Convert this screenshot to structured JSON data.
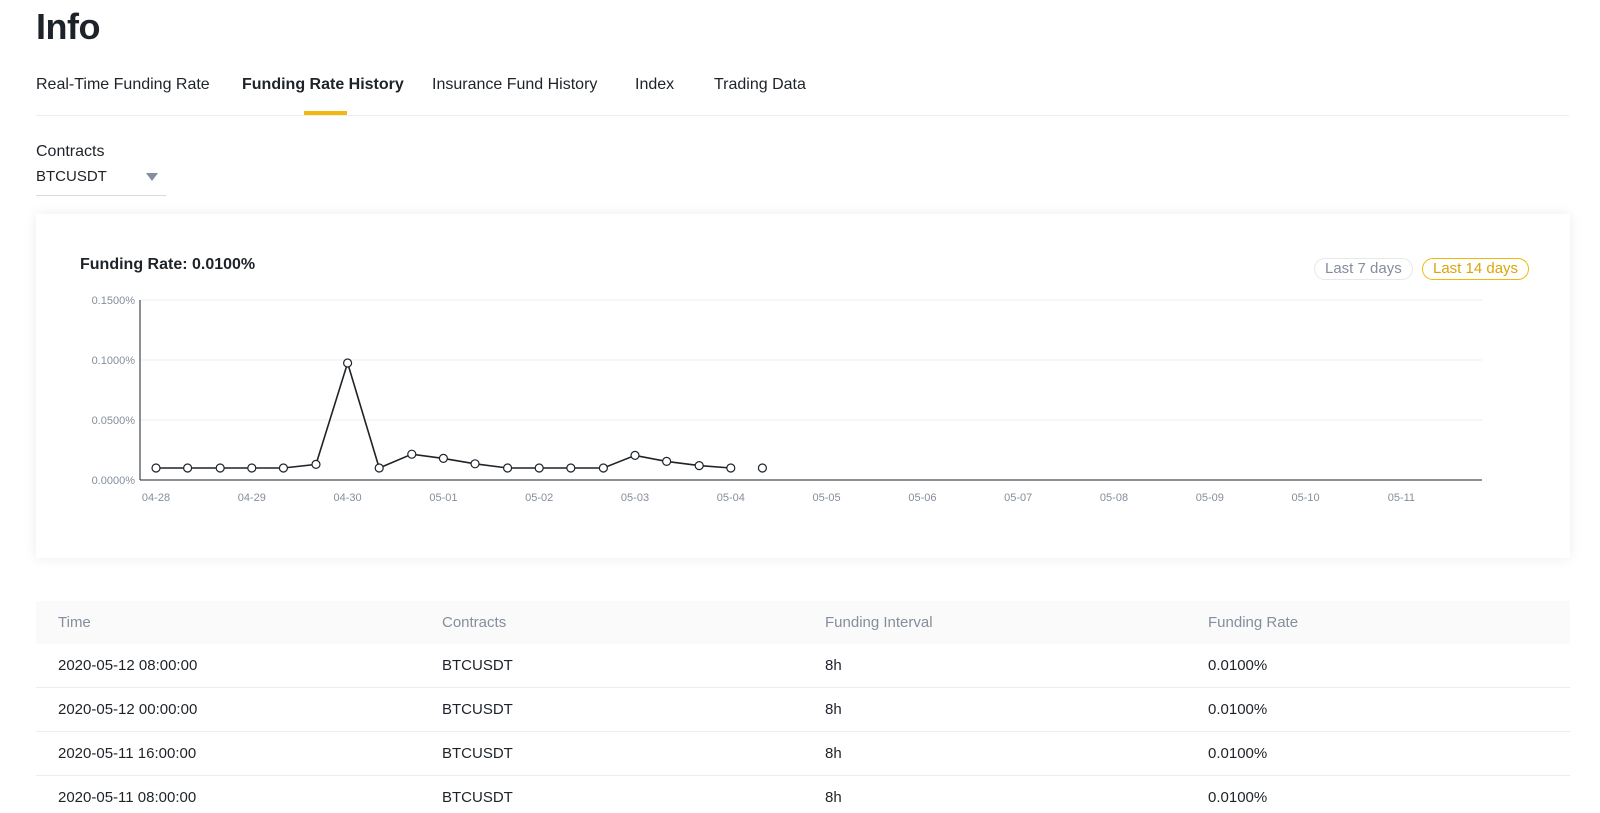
{
  "page": {
    "title": "Info"
  },
  "tabs": [
    {
      "label": "Real-Time Funding Rate",
      "active": false
    },
    {
      "label": "Funding Rate History",
      "active": true
    },
    {
      "label": "Insurance Fund History",
      "active": false
    },
    {
      "label": "Index",
      "active": false
    },
    {
      "label": "Trading Data",
      "active": false
    }
  ],
  "contracts": {
    "label": "Contracts",
    "selected": "BTCUSDT"
  },
  "chart": {
    "title": "Funding Rate: 0.0100%",
    "ranges": [
      "Last 7 days",
      "Last 14 days"
    ],
    "active_range": "Last 14 days",
    "accent_color": "#f0b90b",
    "line_color": "#1e2329"
  },
  "chart_data": {
    "type": "line",
    "title": "Funding Rate: 0.0100%",
    "xlabel": "",
    "ylabel": "",
    "x_tick_labels": [
      "04-28",
      "04-29",
      "04-30",
      "05-01",
      "05-02",
      "05-03",
      "05-04",
      "05-05",
      "05-06",
      "05-07",
      "05-08",
      "05-09",
      "05-10",
      "05-11"
    ],
    "y_tick_labels": [
      "0.0000%",
      "0.0500%",
      "0.1000%",
      "0.1500%"
    ],
    "ylim": [
      0,
      0.15
    ],
    "x_unit": "days since 04-28",
    "grid": true,
    "series": [
      {
        "points": [
          {
            "x": 0.0,
            "y": 0.01
          },
          {
            "x": 0.33,
            "y": 0.01
          },
          {
            "x": 0.67,
            "y": 0.01
          },
          {
            "x": 1.0,
            "y": 0.01
          },
          {
            "x": 1.33,
            "y": 0.01
          },
          {
            "x": 1.67,
            "y": 0.013
          },
          {
            "x": 2.0,
            "y": 0.0975
          },
          {
            "x": 2.33,
            "y": 0.01
          },
          {
            "x": 2.67,
            "y": 0.0215
          },
          {
            "x": 3.0,
            "y": 0.018
          },
          {
            "x": 3.33,
            "y": 0.0135
          },
          {
            "x": 3.67,
            "y": 0.01
          },
          {
            "x": 4.0,
            "y": 0.01
          },
          {
            "x": 4.33,
            "y": 0.01
          },
          {
            "x": 4.67,
            "y": 0.01
          },
          {
            "x": 5.0,
            "y": 0.0205
          },
          {
            "x": 5.33,
            "y": 0.0155
          },
          {
            "x": 5.67,
            "y": 0.012
          },
          {
            "x": 6.0,
            "y": 0.01
          }
        ]
      },
      {
        "points": [
          {
            "x": 6.33,
            "y": 0.01
          }
        ]
      }
    ]
  },
  "table": {
    "headers": [
      "Time",
      "Contracts",
      "Funding Interval",
      "Funding Rate"
    ],
    "rows": [
      [
        "2020-05-12 08:00:00",
        "BTCUSDT",
        "8h",
        "0.0100%"
      ],
      [
        "2020-05-12 00:00:00",
        "BTCUSDT",
        "8h",
        "0.0100%"
      ],
      [
        "2020-05-11 16:00:00",
        "BTCUSDT",
        "8h",
        "0.0100%"
      ],
      [
        "2020-05-11 08:00:00",
        "BTCUSDT",
        "8h",
        "0.0100%"
      ]
    ]
  }
}
